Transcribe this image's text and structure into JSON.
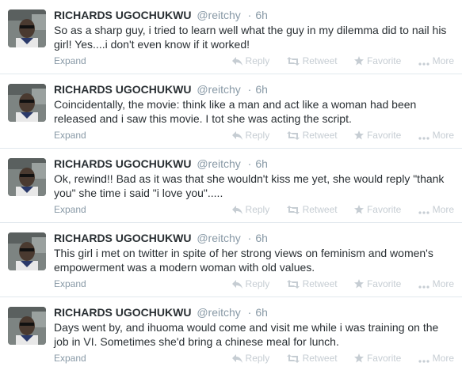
{
  "actions": {
    "expand": "Expand",
    "reply": "Reply",
    "retweet": "Retweet",
    "favorite": "Favorite",
    "more": "More"
  },
  "tweets": [
    {
      "name": "RICHARDS UGOCHUKWU",
      "handle": "@reitchy",
      "separator": "·",
      "time": "6h",
      "text": "So as a sharp guy, i tried to learn well what the guy in my dilemma did to nail his girl! Yes....i don't even know if it worked!"
    },
    {
      "name": "RICHARDS UGOCHUKWU",
      "handle": "@reitchy",
      "separator": "·",
      "time": "6h",
      "text": "Coincidentally, the movie: think like a man and act like a woman had been released and i saw this movie. I tot she was acting the script."
    },
    {
      "name": "RICHARDS UGOCHUKWU",
      "handle": "@reitchy",
      "separator": "·",
      "time": "6h",
      "text": "Ok, rewind!! Bad as it was that she wouldn't kiss me yet, she would reply \"thank you\" she time i said \"i love you\"....."
    },
    {
      "name": "RICHARDS UGOCHUKWU",
      "handle": "@reitchy",
      "separator": "·",
      "time": "6h",
      "text": "This girl i met on twitter in spite of her strong views on feminism and women's empowerment was a modern woman with old values."
    },
    {
      "name": "RICHARDS UGOCHUKWU",
      "handle": "@reitchy",
      "separator": "·",
      "time": "6h",
      "text": "Days went by, and ihuoma would come and visit me while i was training on the job in VI. Sometimes she'd bring a chinese meal for lunch."
    }
  ]
}
